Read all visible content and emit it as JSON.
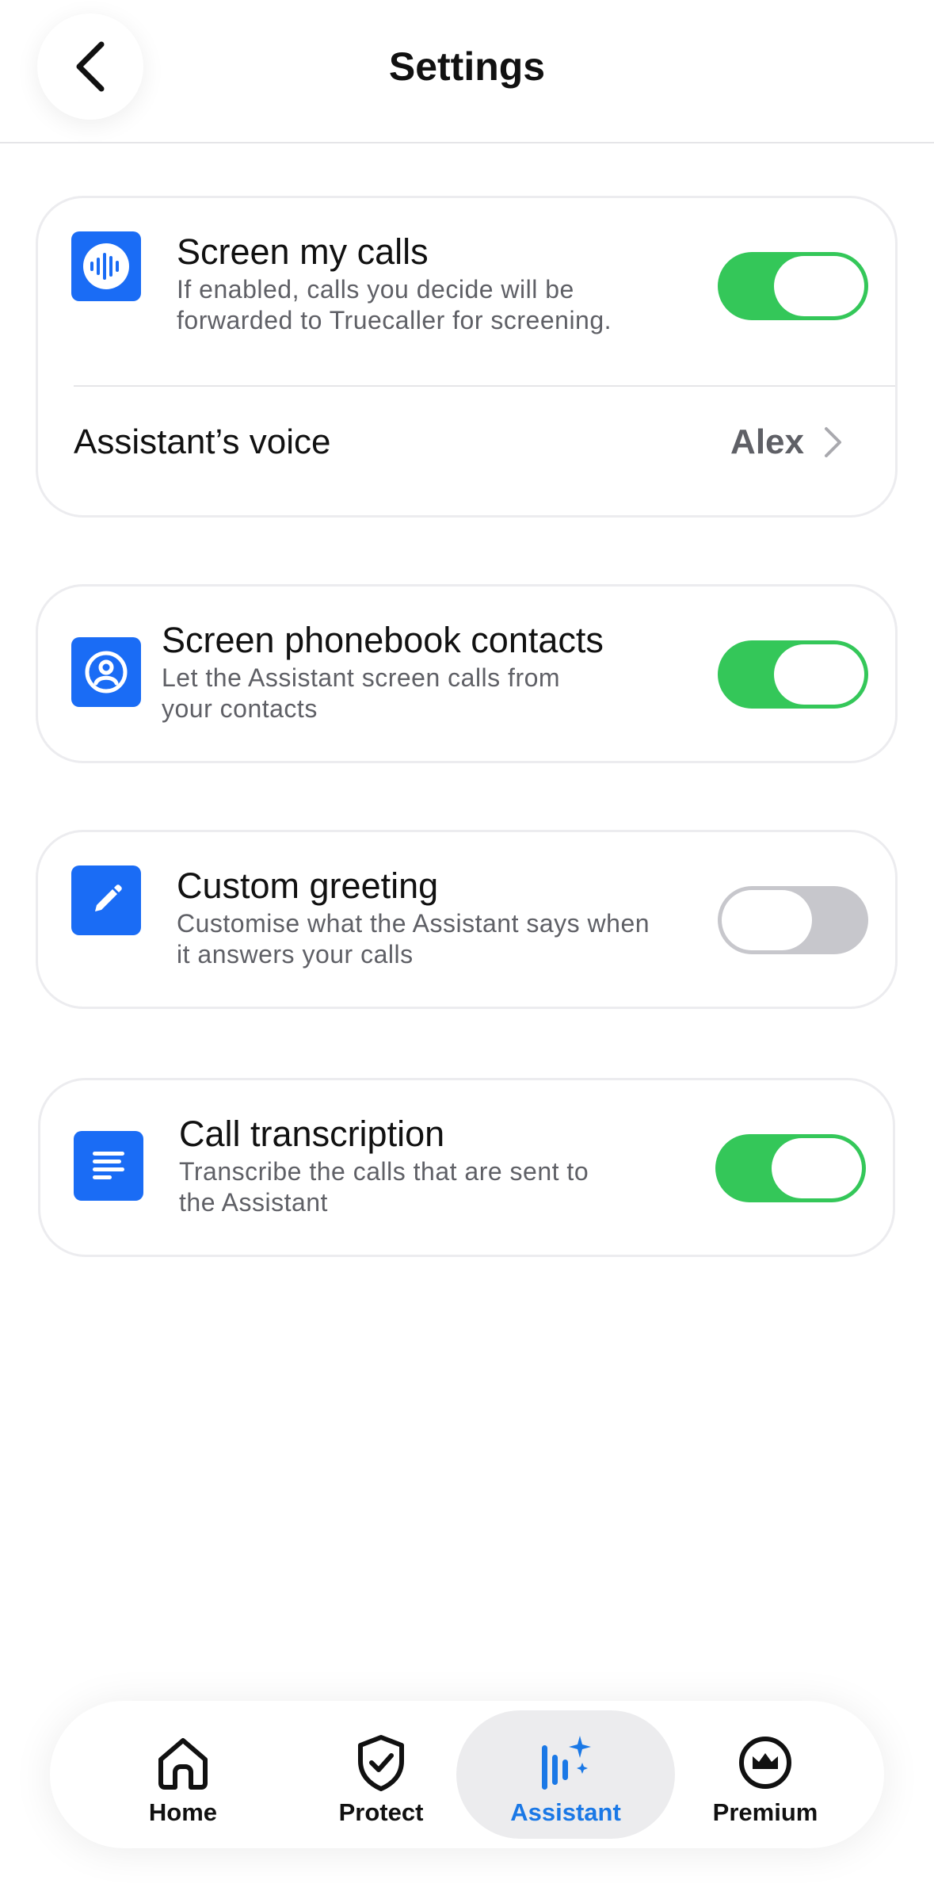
{
  "header": {
    "title": "Settings",
    "back_icon": "chevron-left-icon"
  },
  "cards": {
    "screen_calls": {
      "icon": "waveform-icon",
      "title": "Screen my calls",
      "subtitle": "If enabled, calls you decide will be\nforwarded to Truecaller for screening.",
      "enabled": true
    },
    "voice": {
      "label": "Assistant’s voice",
      "value": "Alex"
    },
    "phonebook": {
      "icon": "contact-icon",
      "title": "Screen phonebook contacts",
      "subtitle": "Let the Assistant screen calls from\nyour contacts",
      "enabled": true
    },
    "greeting": {
      "icon": "pencil-icon",
      "title": "Custom greeting",
      "subtitle": "Customise what the Assistant says when\nit answers your calls",
      "enabled": false
    },
    "transcription": {
      "icon": "document-lines-icon",
      "title": "Call transcription",
      "subtitle": "Transcribe the calls that are sent to\nthe Assistant",
      "enabled": true
    }
  },
  "tabbar": {
    "tabs": [
      {
        "label": "Home",
        "icon": "home-icon",
        "active": false
      },
      {
        "label": "Protect",
        "icon": "shield-check-icon",
        "active": false
      },
      {
        "label": "Assistant",
        "icon": "assistant-sparkle-icon",
        "active": true
      },
      {
        "label": "Premium",
        "icon": "crown-icon",
        "active": false
      }
    ]
  },
  "colors": {
    "accent_blue": "#1a6cf5",
    "toggle_on": "#34c759",
    "toggle_off": "#c7c7cc",
    "active_tab_text": "#1a78e6"
  }
}
